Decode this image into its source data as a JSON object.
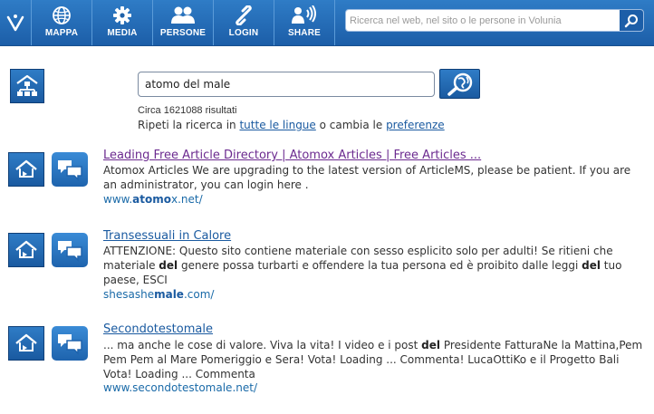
{
  "nav": {
    "items": [
      {
        "label": "MAPPA",
        "icon": "globe-icon"
      },
      {
        "label": "MEDIA",
        "icon": "gear-icon"
      },
      {
        "label": "PERSONE",
        "icon": "people-icon"
      },
      {
        "label": "LOGIN",
        "icon": "link-icon"
      },
      {
        "label": "SHARE",
        "icon": "share-signal-icon"
      }
    ],
    "search_placeholder": "Ricerca nel web, nel sito o le persone in Volunia"
  },
  "search": {
    "query": "atomo del male",
    "count_text": "Circa 1621088 risultati",
    "repeat_prefix": "Ripeti la ricerca in ",
    "all_languages_link": "tutte le lingue",
    "repeat_middle": " o cambia le ",
    "preferences_link": "preferenze"
  },
  "results": [
    {
      "title": "Leading Free Article Directory | Atomox Articles | Free Articles ...",
      "snippet_parts": [
        {
          "t": "Atomox Articles We are upgrading to the latest version of ArticleMS, please be patient. If you are an administrator, you can login here .",
          "b": false
        }
      ],
      "url_parts": [
        {
          "t": "www.",
          "b": false
        },
        {
          "t": "atomo",
          "b": true
        },
        {
          "t": "x.net/",
          "b": false
        }
      ]
    },
    {
      "title": "Transessuali in Calore",
      "snippet_parts": [
        {
          "t": "ATTENZIONE: Questo sito contiene materiale con sesso esplicito solo per adulti! Se ritieni che materiale ",
          "b": false
        },
        {
          "t": "del",
          "b": true
        },
        {
          "t": " genere possa turbarti e offendere la tua persona ed è proibito dalle leggi ",
          "b": false
        },
        {
          "t": "del",
          "b": true
        },
        {
          "t": " tuo paese, ESCI",
          "b": false
        }
      ],
      "url_parts": [
        {
          "t": "shesashe",
          "b": false
        },
        {
          "t": "male",
          "b": true
        },
        {
          "t": ".com/",
          "b": false
        }
      ]
    },
    {
      "title": "Secondotestomale",
      "snippet_parts": [
        {
          "t": "... ma anche le cose di valore. Viva la vita! I video e i post ",
          "b": false
        },
        {
          "t": "del",
          "b": true
        },
        {
          "t": " Presidente FatturaNe la Mattina,Pem Pem Pem al Mare Pomeriggio e Sera! Vota!  Loading ... Commenta! LucaOttiKo e il Progetto Bali Vota!  Loading ... Commenta",
          "b": false
        }
      ],
      "url_parts": [
        {
          "t": "www.secondotestomale.net/",
          "b": false
        }
      ]
    }
  ],
  "colors": {
    "bar_blue": "#1c5ea8",
    "link_blue": "#1a5aa0",
    "visited_purple": "#6b2a8f"
  }
}
